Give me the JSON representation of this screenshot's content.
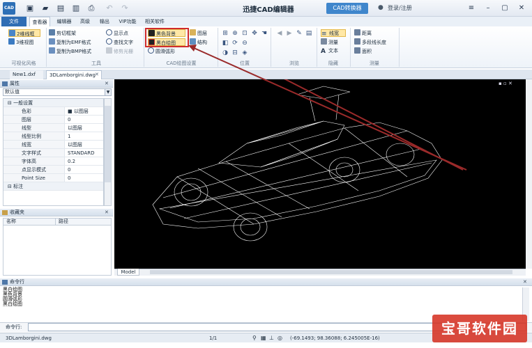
{
  "app": {
    "logo_text": "CAD",
    "title": "迅捷CAD编辑器",
    "ad_button": "CAD转换器",
    "login": "登录/注册"
  },
  "menu_tabs": [
    "文件",
    "查看器",
    "编辑器",
    "高级",
    "输出",
    "VIP功能",
    "相关软件"
  ],
  "ribbon": {
    "view_style": {
      "items": [
        "2维线框",
        "3维视图"
      ],
      "label": "可视化风格"
    },
    "tools": {
      "col1": [
        "剪切框架",
        "复制为EMF格式",
        "复制为BMP格式"
      ],
      "col2": [
        "显示点",
        "查找文字",
        "修剪光栅"
      ],
      "label": "工具"
    },
    "cad_settings": {
      "col1": [
        "黑色背景",
        "黑白绘图",
        "圆滑弧形"
      ],
      "col2": [
        "图层",
        "结构"
      ],
      "label": "CAD绘图设置"
    },
    "position": {
      "label": "位置"
    },
    "browse": {
      "label": "浏览"
    },
    "hide": {
      "items": [
        "线宽",
        "测量",
        "文本"
      ],
      "label": "隐藏"
    },
    "measure": {
      "items": [
        "距离",
        "多段线长度",
        "面积"
      ],
      "label": "测量"
    }
  },
  "doc_tabs": [
    "New1.dxf",
    "3DLamborgini.dwg"
  ],
  "properties": {
    "title": "属性",
    "combo": "默认值",
    "sections": [
      {
        "name": "一般设置",
        "rows": [
          {
            "key": "色彩",
            "value": "以图层"
          },
          {
            "key": "图层",
            "value": "0"
          },
          {
            "key": "线型",
            "value": "以图层"
          },
          {
            "key": "线型比例",
            "value": "1"
          },
          {
            "key": "线宽",
            "value": "以图层"
          },
          {
            "key": "文字样式",
            "value": "STANDARD"
          },
          {
            "key": "字体高",
            "value": "0.2"
          },
          {
            "key": "点显示模式",
            "value": "0"
          },
          {
            "key": "Point Size",
            "value": "0"
          }
        ]
      },
      {
        "name": "标注",
        "rows": []
      }
    ]
  },
  "favorites": {
    "title": "收藏夹",
    "columns": [
      "名称",
      "路径"
    ]
  },
  "canvas": {
    "layout_tab": "Model"
  },
  "command": {
    "title": "命令行",
    "log": [
      "黑白绘图",
      "黑色背景",
      "圆滑弧形",
      "黑白绘图"
    ],
    "prompt": "命令行:"
  },
  "status": {
    "file": "3DLamborgini.dwg",
    "page": "1/1",
    "coords": "(-69.1493; 98.36088; 6.245005E-16)"
  },
  "watermark": "宝哥软件园",
  "colors": {
    "accent": "#2f6db4",
    "highlight_box": "#cf2c2c",
    "canvas_bg": "#000000"
  }
}
